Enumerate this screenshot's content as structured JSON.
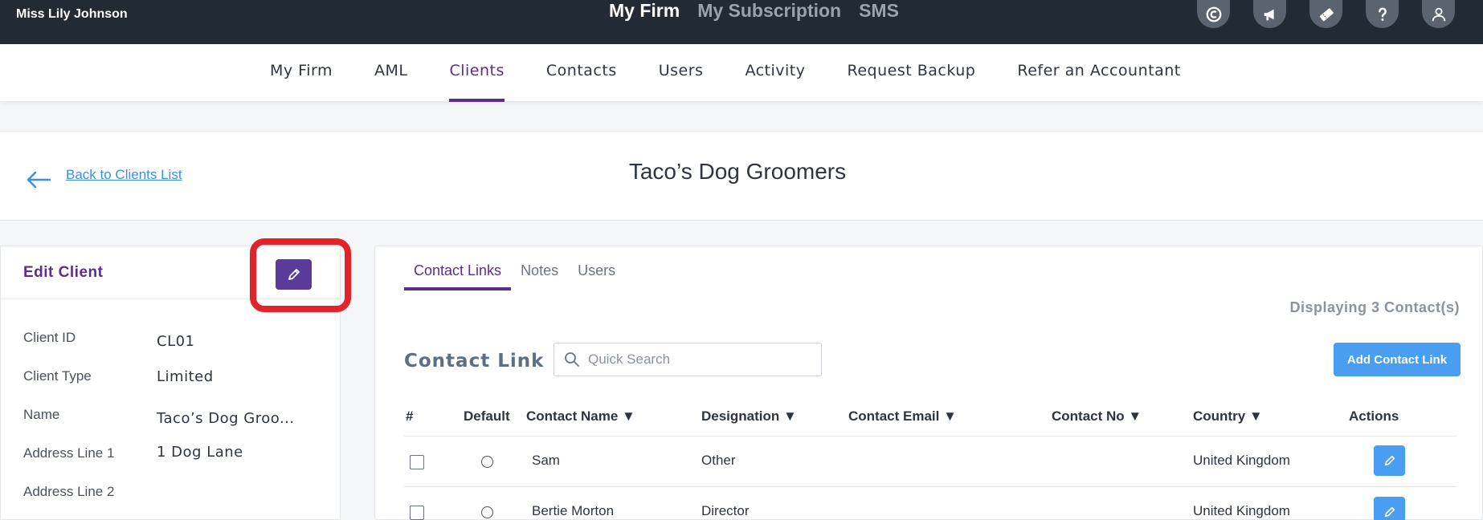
{
  "topbar": {
    "user_name": "Miss Lily Johnson",
    "nav": [
      "My Firm",
      "My Subscription",
      "SMS"
    ],
    "icons": [
      "copyright-icon",
      "megaphone-icon",
      "ticket-icon",
      "help-icon",
      "user-icon"
    ]
  },
  "subnav": {
    "items": [
      "My Firm",
      "AML",
      "Clients",
      "Contacts",
      "Users",
      "Activity",
      "Request Backup",
      "Refer an Accountant"
    ],
    "active": "Clients"
  },
  "title_panel": {
    "back_link": "Back to Clients List",
    "client_name": "Taco’s Dog Groomers"
  },
  "edit_client": {
    "title": "Edit Client",
    "fields": [
      {
        "label": "Client ID",
        "value": "CL01"
      },
      {
        "label": "Client Type",
        "value": "Limited"
      },
      {
        "label": "Name",
        "value": "Taco’s Dog Groo..."
      },
      {
        "label": "Address Line 1",
        "value": "1 Dog Lane"
      },
      {
        "label": "Address Line 2",
        "value": ""
      }
    ]
  },
  "contacts": {
    "tabs": [
      "Contact Links",
      "Notes",
      "Users"
    ],
    "active_tab": "Contact Links",
    "displaying": "Displaying 3 Contact(s)",
    "section_title": "Contact Link",
    "search_placeholder": "Quick Search",
    "add_button": "Add Contact Link",
    "columns": [
      "#",
      "Default",
      "Contact Name ▼",
      "Designation ▼",
      "Contact Email ▼",
      "Contact No ▼",
      "Country ▼",
      "Actions"
    ],
    "rows": [
      {
        "name": "Sam",
        "designation": "Other",
        "email": "",
        "phone": "",
        "country": "United Kingdom"
      },
      {
        "name": "Bertie Morton",
        "designation": "Director",
        "email": "",
        "phone": "",
        "country": "United Kingdom"
      }
    ]
  },
  "colors": {
    "topbar_bg": "#222a35",
    "accent_purple": "#5b2d8e",
    "button_blue": "#4a9ef2",
    "highlight_red": "#e3232a"
  }
}
